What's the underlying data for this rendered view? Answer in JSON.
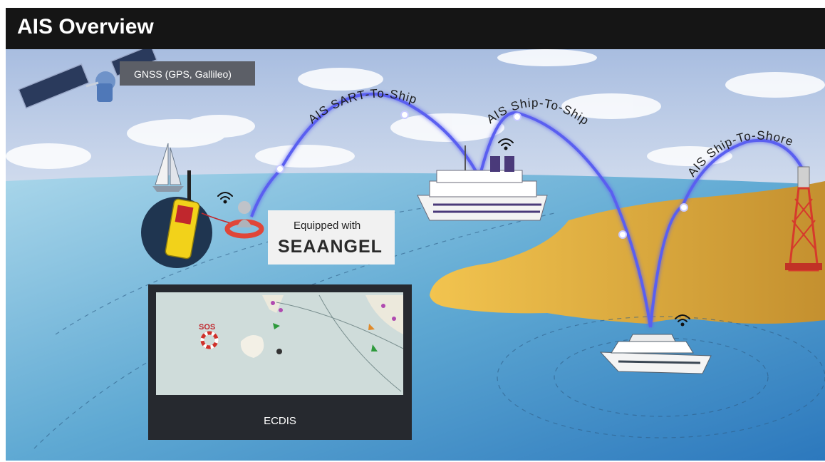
{
  "header": {
    "title": "AIS Overview"
  },
  "gnss": {
    "label": "GNSS (GPS, Gallileo)"
  },
  "links": {
    "sart_to_ship": "AIS SART-To-Ship",
    "ship_to_ship": "AIS Ship-To-Ship",
    "ship_to_shore": "AIS Ship-To-Shore"
  },
  "badge": {
    "equipped": "Equipped with",
    "brand": "SEAANGEL"
  },
  "ecdis": {
    "label": "ECDIS",
    "sos": "SOS"
  },
  "colors": {
    "sky": "#b9c9e4",
    "sea": "#5aa4cf",
    "land": "#e7b84a",
    "beam": "#5b5ff0",
    "sart_yellow": "#f2d21a",
    "title_bg": "#151515"
  },
  "icons": [
    "satellite-icon",
    "sailboat-icon",
    "sart-device-icon",
    "lifebuoy-icon",
    "cruise-ship-icon",
    "yacht-icon",
    "shore-tower-icon",
    "wifi-icon"
  ]
}
